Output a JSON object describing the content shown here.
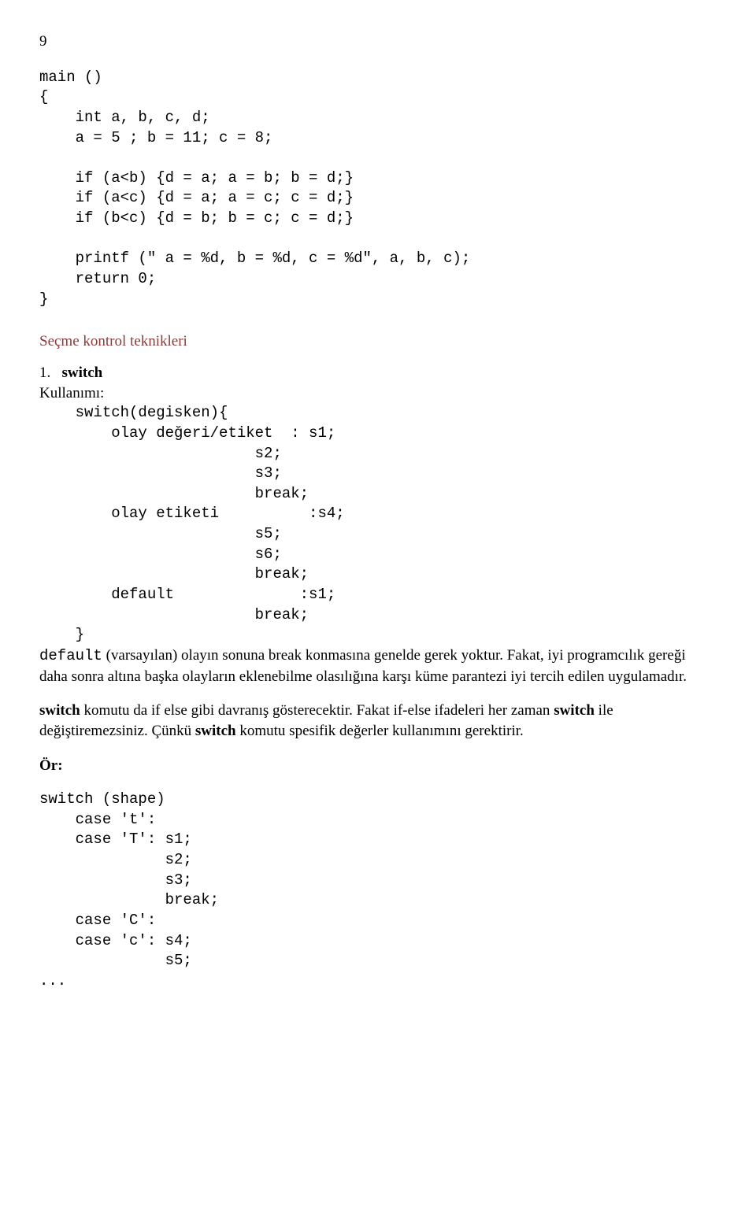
{
  "page_number": "9",
  "code_block_1": "main ()\n{\n    int a, b, c, d;\n    a = 5 ; b = 11; c = 8;\n\n    if (a<b) {d = a; a = b; b = d;}\n    if (a<c) {d = a; a = c; c = d;}\n    if (b<c) {d = b; b = c; c = d;}\n\n    printf (\" a = %d, b = %d, c = %d\", a, b, c);\n    return 0;\n}",
  "heading_1": "Seçme kontrol teknikleri",
  "switch_title_num": "1.",
  "switch_title_bold": "switch",
  "kullanimi": "Kullanımı:",
  "code_block_2": "    switch(degisken){\n        olay değeri/etiket  : s1;\n                        s2;\n                        s3;\n                        break;\n        olay etiketi          :s4;\n                        s5;\n                        s6;\n                        break;\n        default              :s1;\n                        break;\n    }",
  "default_mono": "default",
  "para1_rest": " (varsayılan) olayın sonuna break konmasına genelde gerek yoktur. Fakat, iyi programcılık gereği daha sonra altına başka olayların eklenebilme olasılığına karşı küme parantezi iyi tercih edilen uygulamadır.",
  "para2_bold1": "switch",
  "para2_part1": " komutu da if else gibi davranış gösterecektir. Fakat if-else ifadeleri her zaman ",
  "para2_bold2": "switch",
  "para2_part2": " ile değiştiremezsiniz. Çünkü ",
  "para2_bold3": "switch",
  "para2_part3": " komutu spesifik değerler kullanımını gerektirir.",
  "or_label": "Ör:",
  "code_block_3": "switch (shape)\n    case 't':\n    case 'T': s1;\n              s2;\n              s3;\n              break;\n    case 'C':\n    case 'c': s4;\n              s5;\n...",
  "ellipsis": "..."
}
